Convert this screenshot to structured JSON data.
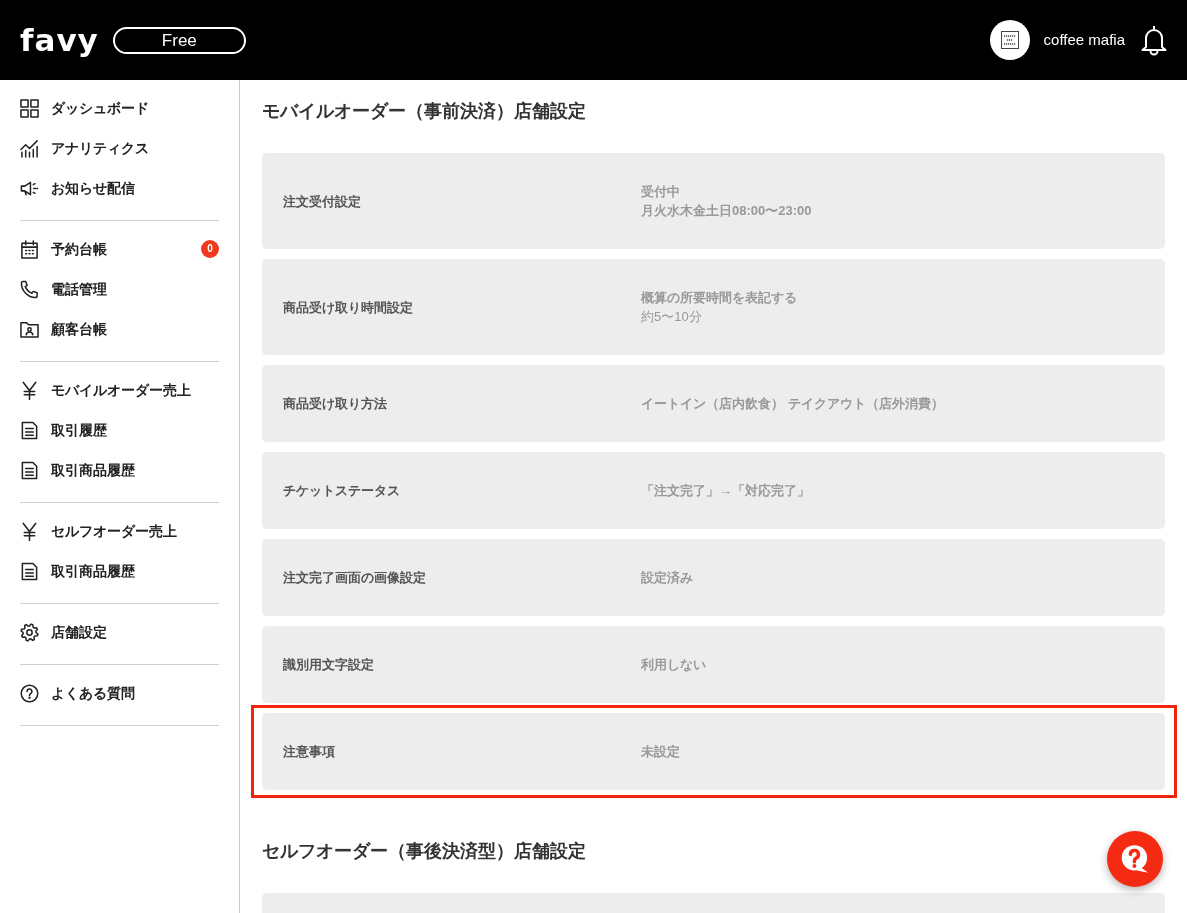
{
  "header": {
    "logo": "favy",
    "plan": "Free",
    "account_name": "coffee mafia"
  },
  "sidebar": {
    "groups": [
      {
        "items": [
          {
            "label": "ダッシュボード"
          },
          {
            "label": "アナリティクス"
          },
          {
            "label": "お知らせ配信"
          }
        ]
      },
      {
        "items": [
          {
            "label": "予約台帳",
            "badge": "0"
          },
          {
            "label": "電話管理"
          },
          {
            "label": "顧客台帳"
          }
        ]
      },
      {
        "items": [
          {
            "label": "モバイルオーダー売上"
          },
          {
            "label": "取引履歴"
          },
          {
            "label": "取引商品履歴"
          }
        ]
      },
      {
        "items": [
          {
            "label": "セルフオーダー売上"
          },
          {
            "label": "取引商品履歴"
          }
        ]
      },
      {
        "items": [
          {
            "label": "店舗設定"
          }
        ]
      },
      {
        "items": [
          {
            "label": "よくある質問"
          }
        ]
      }
    ]
  },
  "sections": [
    {
      "title": "モバイルオーダー（事前決済）店舗設定",
      "cut_off": false,
      "rows": [
        {
          "label": "注文受付設定",
          "highlighted": false,
          "value": [
            {
              "text": "受付中",
              "bold": true
            },
            {
              "text": "月火水木金土日08:00〜23:00",
              "bold": true
            }
          ]
        },
        {
          "label": "商品受け取り時間設定",
          "highlighted": false,
          "value": [
            {
              "text": "概算の所要時間を表記する",
              "bold": true
            },
            {
              "text": "約5〜10分",
              "bold": false
            }
          ]
        },
        {
          "label": "商品受け取り方法",
          "highlighted": false,
          "value": [
            {
              "text": "イートイン（店内飲食） テイクアウト（店外消費）",
              "bold": true
            }
          ]
        },
        {
          "label": "チケットステータス",
          "highlighted": false,
          "value": [
            {
              "text": "「注文完了」→「対応完了」",
              "bold": true
            }
          ]
        },
        {
          "label": "注文完了画面の画像設定",
          "highlighted": false,
          "value": [
            {
              "text": "設定済み",
              "bold": true
            }
          ]
        },
        {
          "label": "識別用文字設定",
          "highlighted": false,
          "value": [
            {
              "text": "利用しない",
              "bold": true
            }
          ]
        },
        {
          "label": "注意事項",
          "highlighted": true,
          "value": [
            {
              "text": "未設定",
              "bold": true
            }
          ]
        }
      ]
    },
    {
      "title": "セルフオーダー（事後決済型）店舗設定",
      "cut_off": true
    }
  ]
}
